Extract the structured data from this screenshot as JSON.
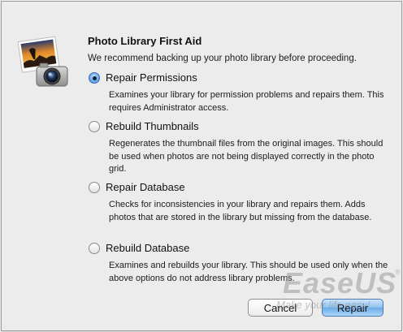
{
  "dialog": {
    "title": "Photo Library First Aid",
    "subtitle": "We recommend backing up your photo library before proceeding."
  },
  "options": [
    {
      "label": "Repair Permissions",
      "description": "Examines your library for permission problems and repairs them. This requires Administrator access.",
      "selected": true
    },
    {
      "label": "Rebuild Thumbnails",
      "description": "Regenerates the thumbnail files from the original images. This should be used when photos are not being displayed correctly in the photo grid.",
      "selected": false
    },
    {
      "label": "Repair Database",
      "description": "Checks for inconsistencies in your library and repairs them. Adds photos that are stored in the library but missing from the database.",
      "selected": false
    },
    {
      "label": "Rebuild Database",
      "description": "Examines and rebuilds your library. This should be used only when the above options do not address library problems.",
      "selected": false
    }
  ],
  "buttons": {
    "cancel": "Cancel",
    "repair": "Repair"
  },
  "watermark": {
    "brand": "EaseUS",
    "tagline": "Make your life easy!",
    "reg": "®"
  },
  "icons": {
    "app": "iphoto-camera-icon"
  },
  "colors": {
    "dialog_bg": "#ececec",
    "default_button": "#8cc0ef",
    "radio_selected": "#3f83d8"
  }
}
